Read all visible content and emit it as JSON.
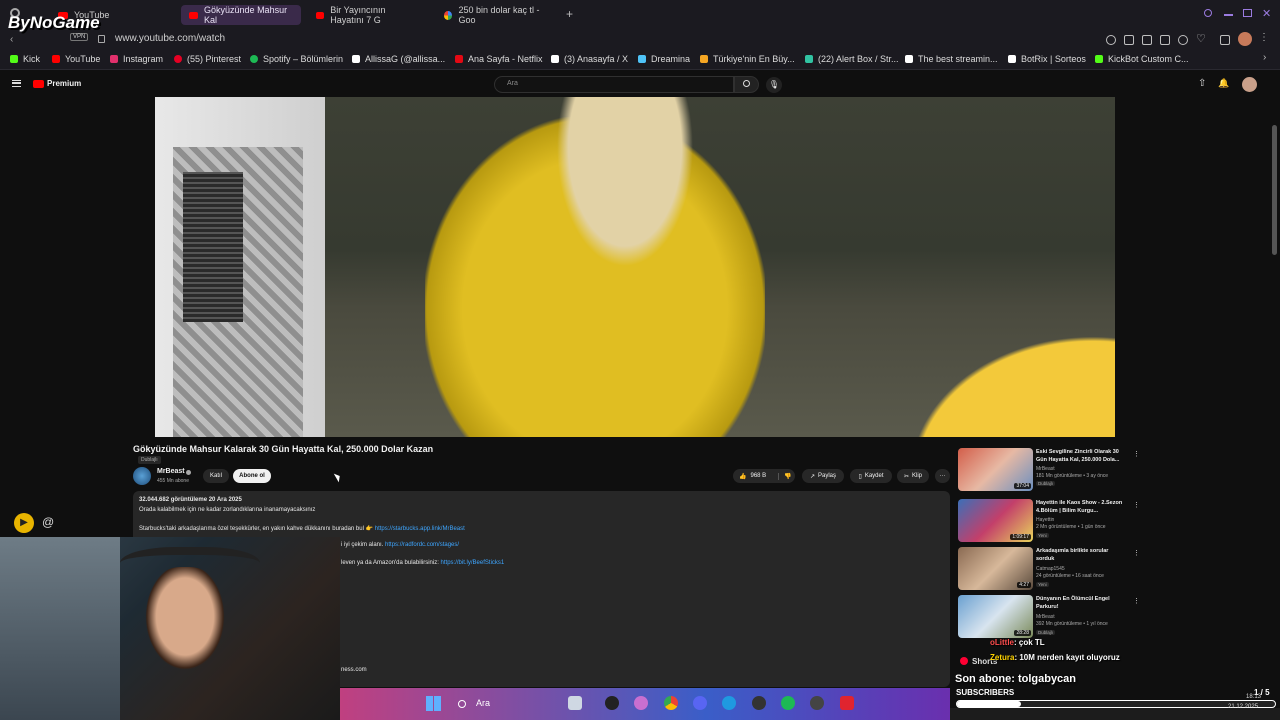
{
  "browser": {
    "tabs": [
      {
        "label": "YouTube"
      },
      {
        "label": "Gökyüzünde Mahsur Kal"
      },
      {
        "label": "Bir Yayıncının Hayatını 7 G"
      },
      {
        "label": "250 bin dolar kaç tl - Goo"
      }
    ],
    "new_tab": "+",
    "url": "www.youtube.com/watch",
    "vpn_badge": "VPN",
    "bookmarks": [
      {
        "label": "Kick",
        "color": "#53fc18"
      },
      {
        "label": "YouTube",
        "color": "#ff0000"
      },
      {
        "label": "Instagram",
        "color": "#e1306c"
      },
      {
        "label": "(55) Pinterest",
        "color": "#e60023"
      },
      {
        "label": "Spotify – Bölümlerin",
        "color": "#1db954"
      },
      {
        "label": "AllissaG (@allissa...",
        "color": "#ffffff"
      },
      {
        "label": "Ana Sayfa - Netflix",
        "color": "#e50914"
      },
      {
        "label": "(3) Anasayfa / X",
        "color": "#ffffff"
      },
      {
        "label": "Dreamina",
        "color": "#4fc3f7"
      },
      {
        "label": "Türkiye'nin En Büy...",
        "color": "#f5a623"
      },
      {
        "label": "(22) Alert Box / Str...",
        "color": "#31c3a2"
      },
      {
        "label": "The best streamin...",
        "color": "#ffffff"
      },
      {
        "label": "BotRix | Sorteos",
        "color": "#ffffff"
      },
      {
        "label": "KickBot Custom C...",
        "color": "#53fc18"
      }
    ]
  },
  "youtube": {
    "logo": "Premium",
    "search_placeholder": "Ara"
  },
  "video": {
    "title": "Gökyüzünde Mahsur Kalarak 30 Gün Hayatta Kal, 250.000 Dolar Kazan",
    "dubbed": "Dublajlı",
    "channel": "MrBeast",
    "subscribers": "455 Mn abone",
    "join_label": "Katıl",
    "subscribe_label": "Abone ol",
    "likes": "968 B",
    "share_label": "Paylaş",
    "save_label": "Kaydet",
    "clip_label": "Klip",
    "more": "···"
  },
  "description": {
    "stats": "32.044.682 görüntüleme  20 Ara 2025",
    "line1": "Orada kalabilmek için ne kadar zorlandıklarına inanamayacaksınız",
    "line2": "Starbucks'taki arkadaşlarıma özel teşekkürler, en yakın kahve dükkanını buradan bul 👉",
    "link2": "https://starbucks.app.link/MrBeast",
    "line3": "i iyi çekim alanı.",
    "link3": "https://radfordc.com/stages/",
    "line4": "leven ya da Amazon'da bulabilirsiniz:",
    "link4": "https://bit.ly/BeefSticks1",
    "line5": "ness.com"
  },
  "recommendations": [
    {
      "title": "Eski Sevgiline Zincirli Olarak 30 Gün Hayatta Kal, 250.000 Dola...",
      "channel": "MrBeast",
      "meta": "181 Mn görüntüleme • 3 ay önce",
      "duration": "37:04",
      "tag": "Dublajlı",
      "thumb": "#c0463a"
    },
    {
      "title": "Hayettin ile Kaos Show - 2.Sezon 4.Bölüm | Bilim Kurgu...",
      "channel": "Hayettin",
      "meta": "2 Mn görüntüleme • 1 gün önce",
      "duration": "1:09:17",
      "tag": "Yeni",
      "thumb": "#3b6fb8"
    },
    {
      "title": "Arkadaşımla birlikte sorular sorduk",
      "channel": "Catmap1545",
      "meta": "24 görüntüleme • 16 saat önce",
      "duration": "4:27",
      "tag": "Yeni",
      "thumb": "#b08a6a"
    },
    {
      "title": "Dünyanın En Ölümcül Engel Parkuru!",
      "channel": "MrBeast",
      "meta": "392 Mn görüntüleme • 1 yıl önce",
      "duration": "28:28",
      "tag": "Dublajlı",
      "thumb": "#6aa0d0"
    }
  ],
  "stream_overlay": {
    "logo": "ByNoGame",
    "chat": [
      {
        "user": "oLittle",
        "msg": ": çok TL",
        "color": "#ff4d4d"
      },
      {
        "user": "Zetura",
        "msg": ": 10M nerden kayıt oluyoruz",
        "color": "#ffd400"
      }
    ],
    "shorts_label": "Shorts",
    "last_sub": "Son abone: tolgabycan",
    "subs_label": "SUBSCRIBERS",
    "subs_count": "1 / 5",
    "subs_progress": 0.2
  },
  "taskbar": {
    "search": "Ara",
    "time": "18:13",
    "date": "21.12.2025"
  }
}
